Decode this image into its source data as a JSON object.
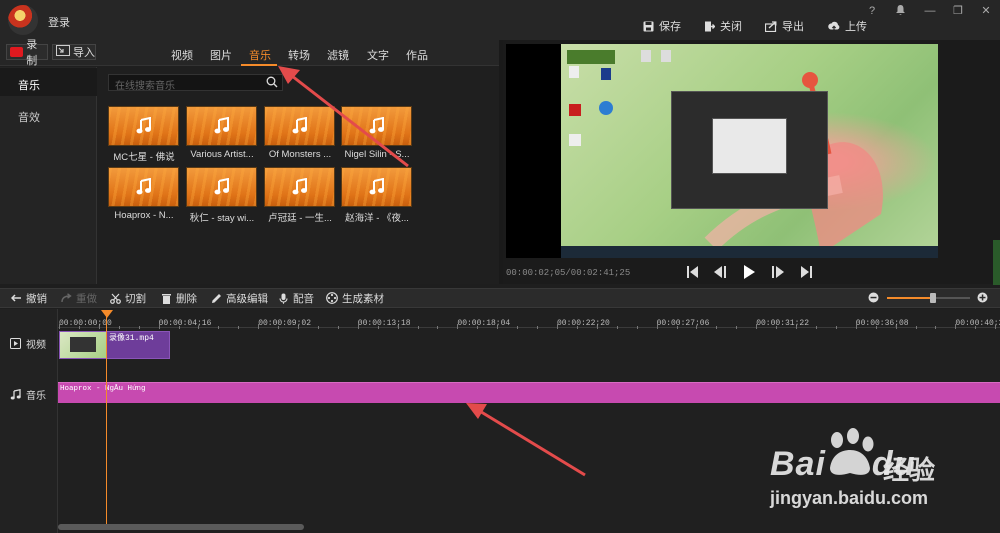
{
  "titlebar": {
    "login_label": "登录",
    "actions": [
      {
        "label": "保存",
        "icon": "save-icon"
      },
      {
        "label": "关闭",
        "icon": "close-project-icon"
      },
      {
        "label": "导出",
        "icon": "export-icon"
      },
      {
        "label": "上传",
        "icon": "upload-icon"
      }
    ],
    "window_buttons": [
      "?",
      "—",
      "❐",
      "✕"
    ]
  },
  "media": {
    "record_label": "录制",
    "import_label": "导入",
    "tabs": [
      "视频",
      "图片",
      "音乐",
      "转场",
      "滤镜",
      "文字",
      "作品"
    ],
    "active_tab": "音乐",
    "side_nav": [
      "音乐",
      "音效"
    ],
    "search_placeholder": "在线搜索音乐",
    "tracks": [
      "MC七星 - 佛说",
      "Various Artist...",
      "Of Monsters ...",
      "Nigel Silin - S...",
      "Hoaprox - N...",
      "秋仁 - stay wi...",
      "卢冠廷 - 一生...",
      "赵海洋 - 《夜..."
    ]
  },
  "preview": {
    "timecode": "00:00:02;05/00:02:41;25"
  },
  "toolbar": {
    "tools": [
      {
        "label": "撤销",
        "icon": "undo-icon",
        "enabled": true
      },
      {
        "label": "重做",
        "icon": "redo-icon",
        "enabled": false
      },
      {
        "label": "切割",
        "icon": "scissors-icon",
        "enabled": true
      },
      {
        "label": "删除",
        "icon": "trash-icon",
        "enabled": true
      },
      {
        "label": "高级编辑",
        "icon": "pencil-icon",
        "enabled": true
      },
      {
        "label": "配音",
        "icon": "microphone-icon",
        "enabled": true
      },
      {
        "label": "生成素材",
        "icon": "film-reel-icon",
        "enabled": true
      }
    ],
    "zoom_level": 0.55
  },
  "timeline": {
    "ruler": [
      "00:00:00;00",
      "00:00:04;16",
      "00:00:09;02",
      "00:00:13;18",
      "00:00:18;04",
      "00:00:22;20",
      "00:00:27;06",
      "00:00:31;22",
      "00:00:36;08",
      "00:00:40;24"
    ],
    "tracks": {
      "video_label": "视频",
      "music_label": "音乐"
    },
    "video_clip": "录像31.mp4",
    "music_clip": "Hoaprox - NgÅu Hứng"
  },
  "watermark": {
    "brand": "Bai",
    "brand2": "du",
    "sub": "经验",
    "url": "jingyan.baidu.com"
  }
}
